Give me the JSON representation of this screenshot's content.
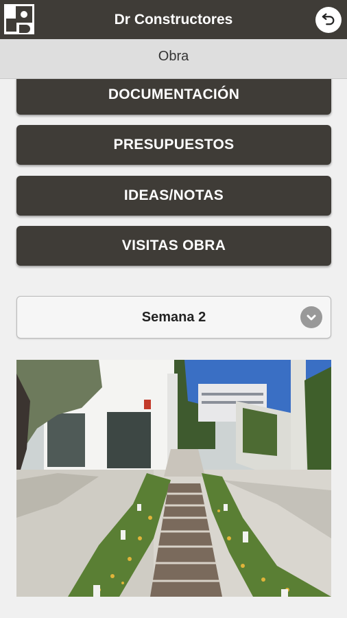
{
  "header": {
    "app_title": "Dr Constructores",
    "logo_icon": "dr-constructores-logo",
    "back_icon": "undo-arrow-icon"
  },
  "subheader": {
    "title": "Obra"
  },
  "menu": [
    {
      "label": "DOCUMENTACIÓN"
    },
    {
      "label": "PRESUPUESTOS"
    },
    {
      "label": "IDEAS/NOTAS"
    },
    {
      "label": "VISITAS OBRA"
    }
  ],
  "week_select": {
    "selected": "Semana 2",
    "icon": "chevron-down-icon"
  },
  "photo": {
    "subject": "garden-path-with-wooden-steps-and-white-building"
  },
  "colors": {
    "bar": "#3f3c37",
    "subbar": "#dedede",
    "background": "#f0f0f0"
  }
}
